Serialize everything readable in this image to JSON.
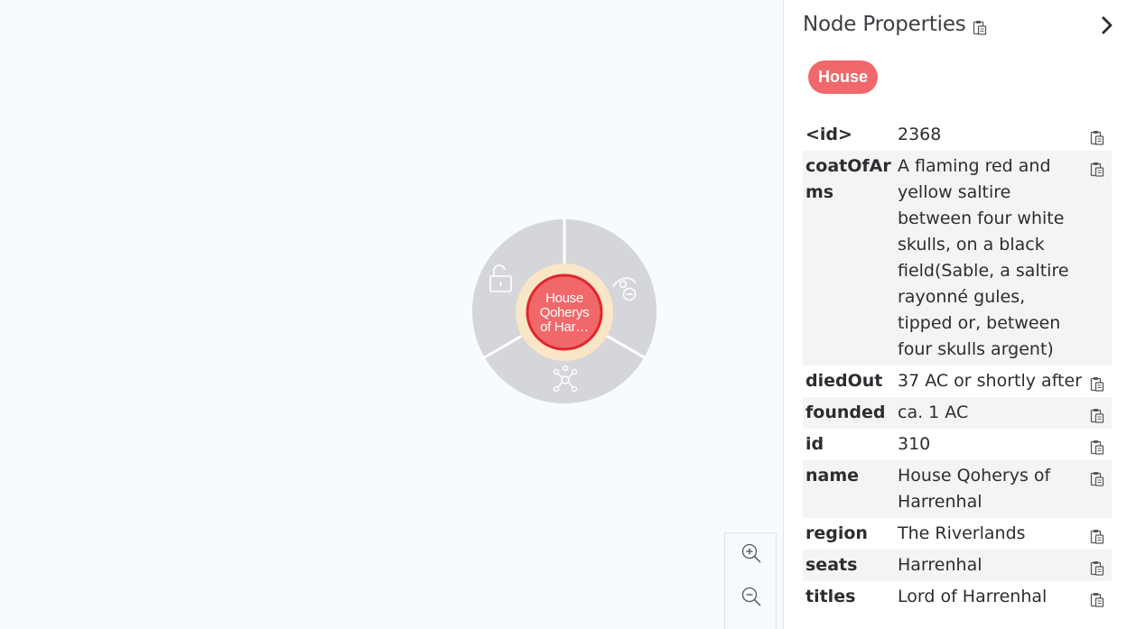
{
  "colors": {
    "node_fill": "#f0686a",
    "node_border": "#e2262d",
    "node_halo": "#f9e6c6",
    "ring_menu": "#d4d6d9",
    "badge": "#f0686a",
    "panel_text": "#2b2d30"
  },
  "node": {
    "caption_lines": [
      "House",
      "Qoherys",
      "of Har…"
    ],
    "menu_icons": [
      "unlock-icon",
      "hide-eye-icon",
      "expand-network-icon"
    ]
  },
  "zoom": {
    "in_icon": "zoom-in-icon",
    "out_icon": "zoom-out-icon"
  },
  "panel": {
    "title": "Node Properties",
    "label": "House",
    "properties": [
      {
        "key": "<id>",
        "value": "2368"
      },
      {
        "key": "coatOfArms",
        "value": "A flaming red and yellow saltire between four white skulls, on a black field(Sable, a saltire rayonné gules, tipped or, between four skulls argent)"
      },
      {
        "key": "diedOut",
        "value": "37 AC or shortly after"
      },
      {
        "key": "founded",
        "value": "ca. 1 AC"
      },
      {
        "key": "id",
        "value": "310"
      },
      {
        "key": "name",
        "value": "House Qoherys of Harrenhal"
      },
      {
        "key": "region",
        "value": "The Riverlands"
      },
      {
        "key": "seats",
        "value": "Harrenhal"
      },
      {
        "key": "titles",
        "value": "Lord of Harrenhal"
      }
    ]
  }
}
